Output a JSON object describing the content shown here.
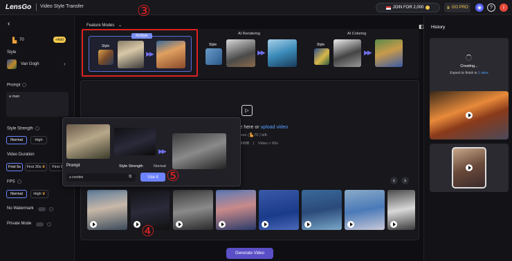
{
  "topbar": {
    "logo": "LensGo",
    "app_title": "Video Style Transfer",
    "join_label": "JOIN FOR 2,000",
    "gopro_label": "GO PRO",
    "profile_letter": "I"
  },
  "sidebar": {
    "credits": "70",
    "add_label": "Add",
    "style_label": "Style",
    "style_value": "Van Gogh",
    "prompt_label": "Prompt",
    "prompt_value": "a man",
    "strength_label": "Style Strength",
    "strength_options": [
      "Normal",
      "High"
    ],
    "duration_label": "Video Duration",
    "duration_options": [
      "First 5s",
      "First 30s",
      "First 6"
    ],
    "fps_label": "FPS",
    "fps_options": [
      "Normal",
      "High"
    ],
    "no_watermark_label": "No Watermark",
    "private_mode_label": "Private Mode"
  },
  "feature": {
    "dropdown_label": "Feature Modes",
    "cards": [
      {
        "tag": "ReStyle",
        "style_label": "Style"
      },
      {
        "tag": "AI Rendering",
        "style_label": "Style"
      },
      {
        "tag": "AI Coloring",
        "style_label": "Style"
      }
    ]
  },
  "upload": {
    "text": "le here or",
    "link": "upload video",
    "sub1_a": "sec (",
    "sub1_b": "70 ) left.",
    "sub2_a": "00MB",
    "sub2_b": "Video < 60s"
  },
  "popup": {
    "prompt_label": "Prompt",
    "prompt_value": "a zombie",
    "strength_label": "Style Strength",
    "strength_value": "Normal",
    "use_button": "Use it"
  },
  "annotations": [
    "③",
    "④",
    "⑤"
  ],
  "gallery": {
    "prev": "‹",
    "next": "›"
  },
  "generate_button": "Generate Video",
  "history": {
    "title": "History",
    "creating": "Creating...",
    "expect_a": "Expect to finish in",
    "expect_b": "1 mins"
  },
  "colors": {
    "accent": "#6e83ff",
    "link": "#5aa0ff",
    "generate": "#5b4fc7",
    "annotation": "#e02020"
  }
}
